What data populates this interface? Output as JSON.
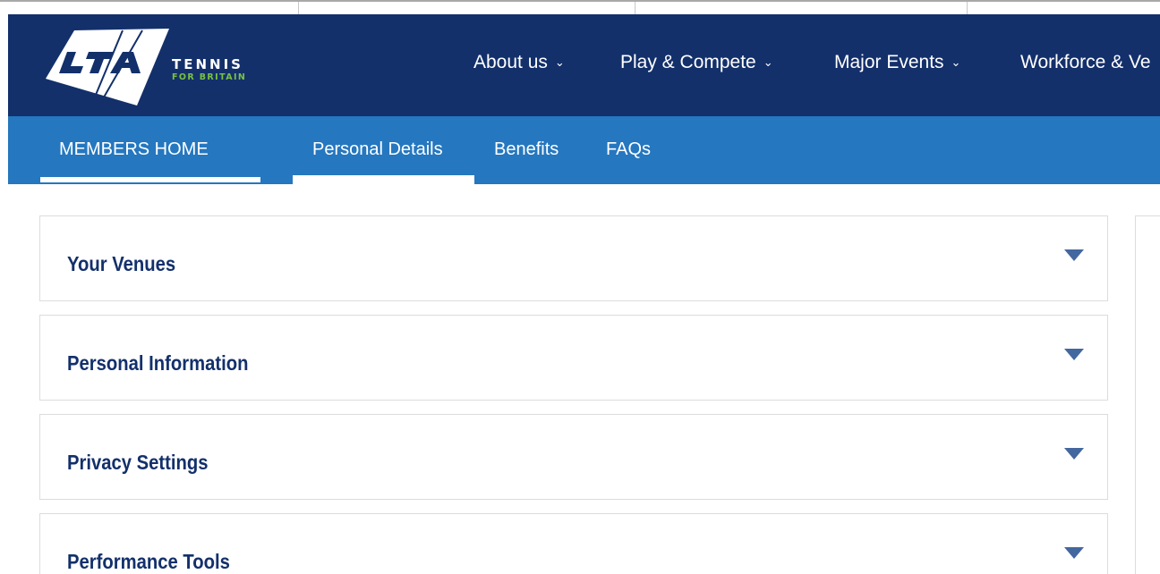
{
  "brand": {
    "logo_letters": "LTA",
    "line1": "TENNIS",
    "line2": "FOR BRITAIN",
    "colors": {
      "navy": "#13306b",
      "blue": "#2577bf",
      "green": "#7ac142"
    }
  },
  "main_nav": {
    "items": [
      {
        "label": "About us",
        "icon": "chevron-down-icon"
      },
      {
        "label": "Play & Compete",
        "icon": "chevron-down-icon"
      },
      {
        "label": "Major Events",
        "icon": "chevron-down-icon"
      },
      {
        "label": "Workforce & Ve",
        "icon": ""
      }
    ]
  },
  "sub_nav": {
    "tabs": [
      {
        "label": "MEMBERS HOME"
      },
      {
        "label": "Personal Details",
        "active": true
      },
      {
        "label": "Benefits"
      },
      {
        "label": "FAQs"
      }
    ]
  },
  "panels": [
    {
      "title": "Your Venues",
      "icon": "triangle-down-icon"
    },
    {
      "title": "Personal Information",
      "icon": "triangle-down-icon"
    },
    {
      "title": "Privacy Settings",
      "icon": "triangle-down-icon"
    },
    {
      "title": "Performance Tools",
      "icon": "triangle-down-icon"
    }
  ]
}
